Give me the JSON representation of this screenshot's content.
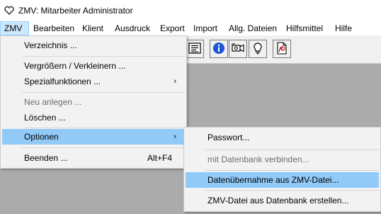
{
  "window": {
    "title": "ZMV: Mitarbeiter Administrator"
  },
  "menubar": {
    "items": [
      {
        "label": "ZMV"
      },
      {
        "label": "Bearbeiten"
      },
      {
        "label": "Klient"
      },
      {
        "label": "Ausdruck"
      },
      {
        "label": "Export"
      },
      {
        "label": "Import"
      },
      {
        "label": "Allg. Dateien"
      },
      {
        "label": "Hilfsmittel"
      },
      {
        "label": "Hilfe"
      }
    ]
  },
  "toolbar": {
    "buttons": [
      {
        "icon": "list-document-icon"
      },
      {
        "icon": "info-icon"
      },
      {
        "icon": "camera-icon"
      },
      {
        "icon": "lightbulb-icon"
      },
      {
        "icon": "pdf-document-icon"
      }
    ]
  },
  "zmv_menu": {
    "items": [
      {
        "label": "Verzeichnis ..."
      },
      {
        "label": "Vergrößern / Verkleinern ..."
      },
      {
        "label": "Spezialfunktionen ...",
        "arrow": "›"
      },
      {
        "label": "Neu anlegen ..."
      },
      {
        "label": "Löschen ..."
      },
      {
        "label": "Optionen",
        "arrow": "›"
      },
      {
        "label": "Beenden ...",
        "shortcut": "Alt+F4"
      }
    ]
  },
  "optionen_submenu": {
    "items": [
      {
        "label": "Passwort..."
      },
      {
        "label": "mit Datenbank verbinden..."
      },
      {
        "label": "Datenübernahme aus ZMV-Datei..."
      },
      {
        "label": "ZMV-Datei aus Datenbank erstellen..."
      }
    ]
  },
  "colors": {
    "highlight": "#91c9f7",
    "active_menu": "#cce8ff",
    "workspace": "#ababab",
    "menu_bg": "#f2f2f2"
  }
}
